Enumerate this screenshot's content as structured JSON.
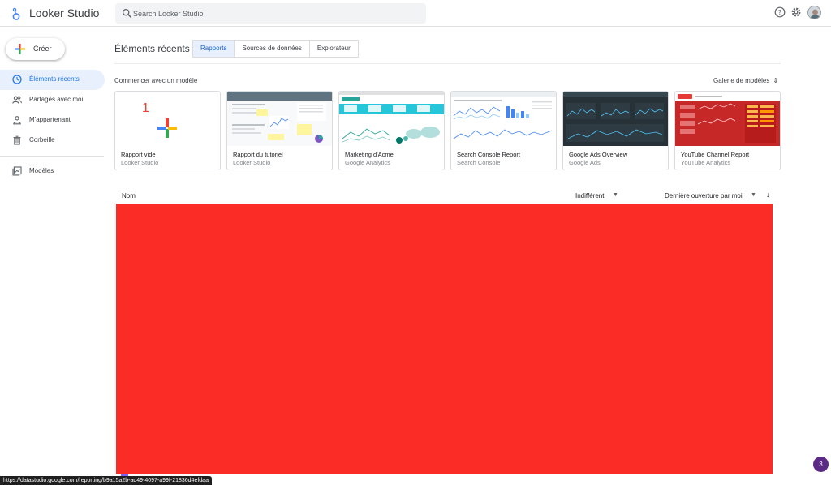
{
  "app": {
    "title": "Looker Studio"
  },
  "search": {
    "placeholder": "Search Looker Studio"
  },
  "top_icons": [
    "help-icon",
    "settings-icon",
    "avatar"
  ],
  "sidebar": {
    "create_label": "Créer",
    "items": [
      {
        "label": "Éléments récents",
        "icon": "clock-icon",
        "active": true
      },
      {
        "label": "Partagés avec moi",
        "icon": "people-icon",
        "active": false
      },
      {
        "label": "M'appartenant",
        "icon": "person-icon",
        "active": false
      },
      {
        "label": "Corbeille",
        "icon": "trash-icon",
        "active": false
      },
      {
        "label": "Modèles",
        "icon": "templates-icon",
        "active": false
      }
    ]
  },
  "main": {
    "title": "Éléments récents",
    "tabs": [
      {
        "label": "Rapports",
        "active": true
      },
      {
        "label": "Sources de données",
        "active": false
      },
      {
        "label": "Explorateur",
        "active": false
      }
    ],
    "templates_label": "Commencer avec un modèle",
    "gallery_label": "Galerie de modèles",
    "templates": [
      {
        "name": "Rapport vide",
        "source": "Looker Studio",
        "badge": "1"
      },
      {
        "name": "Rapport du tutoriel",
        "source": "Looker Studio"
      },
      {
        "name": "Marketing d'Acme",
        "source": "Google Analytics"
      },
      {
        "name": "Search Console Report",
        "source": "Search Console"
      },
      {
        "name": "Google Ads Overview",
        "source": "Google Ads"
      },
      {
        "name": "YouTube Channel Report",
        "source": "YouTube Analytics"
      }
    ],
    "list_header": {
      "name": "Nom",
      "owner_filter": "Indifférent",
      "sort_label": "Dernière ouverture par moi"
    }
  },
  "status_url": "https://datastudio.google.com/reporting/b9a15a2b-ad49-4097-a99f-21836d4efdaa",
  "fab_label": "3",
  "colors": {
    "accent": "#1a73e8",
    "active_bg": "#e8f0fe",
    "redaction": "#fb2b25",
    "fab": "#5b2a86"
  }
}
